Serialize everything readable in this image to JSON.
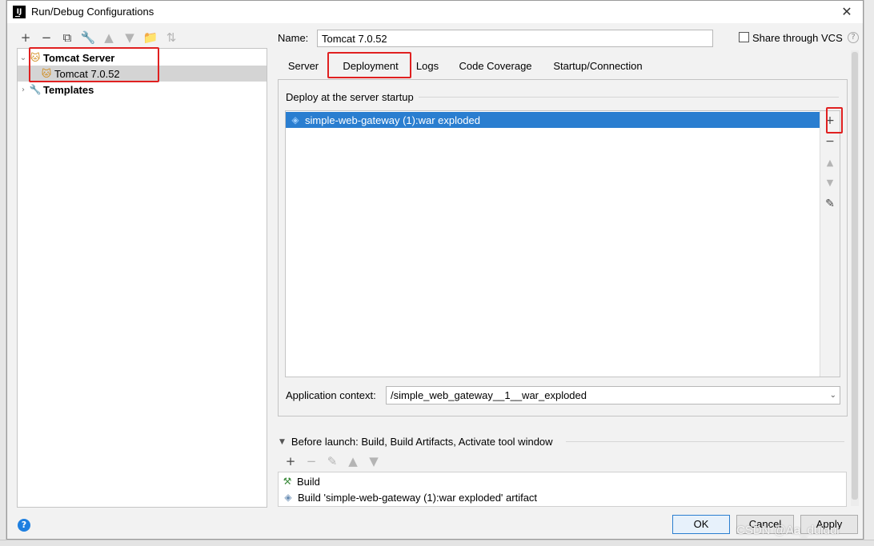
{
  "window": {
    "title": "Run/Debug Configurations",
    "app_icon_text": "IJ",
    "close_glyph": "✕"
  },
  "left_toolbar": {
    "add": "+",
    "remove": "−",
    "copy": "⧉",
    "edit": "🔧",
    "move_up": "▲",
    "move_down": "▼",
    "folder": "📁",
    "sort": "⇅"
  },
  "tree": {
    "items": [
      {
        "label": "Tomcat Server",
        "expanded": true,
        "bold": true
      },
      {
        "label": "Tomcat 7.0.52",
        "selected": true
      },
      {
        "label": "Templates",
        "expanded": false,
        "bold": true
      }
    ]
  },
  "name_field": {
    "label": "Name:",
    "value": "Tomcat 7.0.52"
  },
  "share": {
    "label": "Share through VCS",
    "checked": false,
    "help": "?"
  },
  "tabs": [
    {
      "label": "Server"
    },
    {
      "label": "Deployment",
      "active": true
    },
    {
      "label": "Logs"
    },
    {
      "label": "Code Coverage"
    },
    {
      "label": "Startup/Connection"
    }
  ],
  "deployment": {
    "section_label": "Deploy at the server startup",
    "items": [
      "simple-web-gateway (1):war exploded"
    ],
    "side_buttons": {
      "add": "+",
      "remove": "−",
      "up": "▲",
      "down": "▼",
      "edit": "✎"
    }
  },
  "app_context": {
    "label": "Application context:",
    "value": "/simple_web_gateway__1__war_exploded"
  },
  "before_launch": {
    "label": "Before launch: Build, Build Artifacts, Activate tool window",
    "toolbar": {
      "add": "+",
      "remove": "−",
      "edit": "✎",
      "up": "▲",
      "down": "▼"
    },
    "items": [
      "Build",
      "Build 'simple-web-gateway (1):war exploded' artifact"
    ]
  },
  "footer": {
    "help": "?",
    "ok": "OK",
    "cancel": "Cancel",
    "apply": "Apply"
  },
  "watermark": "CSDN @Aa_duidui",
  "colors": {
    "selection": "#2a7ed0",
    "highlight_box": "#e02020"
  }
}
